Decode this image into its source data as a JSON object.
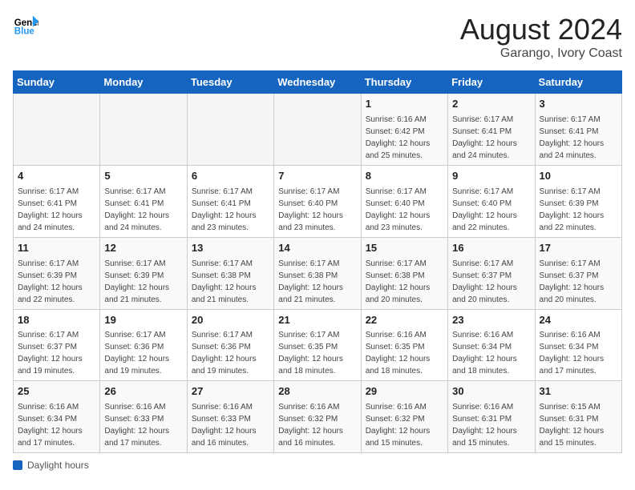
{
  "header": {
    "logo_line1": "General",
    "logo_line2": "Blue",
    "month_year": "August 2024",
    "location": "Garango, Ivory Coast"
  },
  "days_of_week": [
    "Sunday",
    "Monday",
    "Tuesday",
    "Wednesday",
    "Thursday",
    "Friday",
    "Saturday"
  ],
  "weeks": [
    [
      {
        "day": "",
        "info": ""
      },
      {
        "day": "",
        "info": ""
      },
      {
        "day": "",
        "info": ""
      },
      {
        "day": "",
        "info": ""
      },
      {
        "day": "1",
        "info": "Sunrise: 6:16 AM\nSunset: 6:42 PM\nDaylight: 12 hours\nand 25 minutes."
      },
      {
        "day": "2",
        "info": "Sunrise: 6:17 AM\nSunset: 6:41 PM\nDaylight: 12 hours\nand 24 minutes."
      },
      {
        "day": "3",
        "info": "Sunrise: 6:17 AM\nSunset: 6:41 PM\nDaylight: 12 hours\nand 24 minutes."
      }
    ],
    [
      {
        "day": "4",
        "info": "Sunrise: 6:17 AM\nSunset: 6:41 PM\nDaylight: 12 hours\nand 24 minutes."
      },
      {
        "day": "5",
        "info": "Sunrise: 6:17 AM\nSunset: 6:41 PM\nDaylight: 12 hours\nand 24 minutes."
      },
      {
        "day": "6",
        "info": "Sunrise: 6:17 AM\nSunset: 6:41 PM\nDaylight: 12 hours\nand 23 minutes."
      },
      {
        "day": "7",
        "info": "Sunrise: 6:17 AM\nSunset: 6:40 PM\nDaylight: 12 hours\nand 23 minutes."
      },
      {
        "day": "8",
        "info": "Sunrise: 6:17 AM\nSunset: 6:40 PM\nDaylight: 12 hours\nand 23 minutes."
      },
      {
        "day": "9",
        "info": "Sunrise: 6:17 AM\nSunset: 6:40 PM\nDaylight: 12 hours\nand 22 minutes."
      },
      {
        "day": "10",
        "info": "Sunrise: 6:17 AM\nSunset: 6:39 PM\nDaylight: 12 hours\nand 22 minutes."
      }
    ],
    [
      {
        "day": "11",
        "info": "Sunrise: 6:17 AM\nSunset: 6:39 PM\nDaylight: 12 hours\nand 22 minutes."
      },
      {
        "day": "12",
        "info": "Sunrise: 6:17 AM\nSunset: 6:39 PM\nDaylight: 12 hours\nand 21 minutes."
      },
      {
        "day": "13",
        "info": "Sunrise: 6:17 AM\nSunset: 6:38 PM\nDaylight: 12 hours\nand 21 minutes."
      },
      {
        "day": "14",
        "info": "Sunrise: 6:17 AM\nSunset: 6:38 PM\nDaylight: 12 hours\nand 21 minutes."
      },
      {
        "day": "15",
        "info": "Sunrise: 6:17 AM\nSunset: 6:38 PM\nDaylight: 12 hours\nand 20 minutes."
      },
      {
        "day": "16",
        "info": "Sunrise: 6:17 AM\nSunset: 6:37 PM\nDaylight: 12 hours\nand 20 minutes."
      },
      {
        "day": "17",
        "info": "Sunrise: 6:17 AM\nSunset: 6:37 PM\nDaylight: 12 hours\nand 20 minutes."
      }
    ],
    [
      {
        "day": "18",
        "info": "Sunrise: 6:17 AM\nSunset: 6:37 PM\nDaylight: 12 hours\nand 19 minutes."
      },
      {
        "day": "19",
        "info": "Sunrise: 6:17 AM\nSunset: 6:36 PM\nDaylight: 12 hours\nand 19 minutes."
      },
      {
        "day": "20",
        "info": "Sunrise: 6:17 AM\nSunset: 6:36 PM\nDaylight: 12 hours\nand 19 minutes."
      },
      {
        "day": "21",
        "info": "Sunrise: 6:17 AM\nSunset: 6:35 PM\nDaylight: 12 hours\nand 18 minutes."
      },
      {
        "day": "22",
        "info": "Sunrise: 6:16 AM\nSunset: 6:35 PM\nDaylight: 12 hours\nand 18 minutes."
      },
      {
        "day": "23",
        "info": "Sunrise: 6:16 AM\nSunset: 6:34 PM\nDaylight: 12 hours\nand 18 minutes."
      },
      {
        "day": "24",
        "info": "Sunrise: 6:16 AM\nSunset: 6:34 PM\nDaylight: 12 hours\nand 17 minutes."
      }
    ],
    [
      {
        "day": "25",
        "info": "Sunrise: 6:16 AM\nSunset: 6:34 PM\nDaylight: 12 hours\nand 17 minutes."
      },
      {
        "day": "26",
        "info": "Sunrise: 6:16 AM\nSunset: 6:33 PM\nDaylight: 12 hours\nand 17 minutes."
      },
      {
        "day": "27",
        "info": "Sunrise: 6:16 AM\nSunset: 6:33 PM\nDaylight: 12 hours\nand 16 minutes."
      },
      {
        "day": "28",
        "info": "Sunrise: 6:16 AM\nSunset: 6:32 PM\nDaylight: 12 hours\nand 16 minutes."
      },
      {
        "day": "29",
        "info": "Sunrise: 6:16 AM\nSunset: 6:32 PM\nDaylight: 12 hours\nand 15 minutes."
      },
      {
        "day": "30",
        "info": "Sunrise: 6:16 AM\nSunset: 6:31 PM\nDaylight: 12 hours\nand 15 minutes."
      },
      {
        "day": "31",
        "info": "Sunrise: 6:15 AM\nSunset: 6:31 PM\nDaylight: 12 hours\nand 15 minutes."
      }
    ]
  ],
  "footer": {
    "label": "Daylight hours"
  }
}
